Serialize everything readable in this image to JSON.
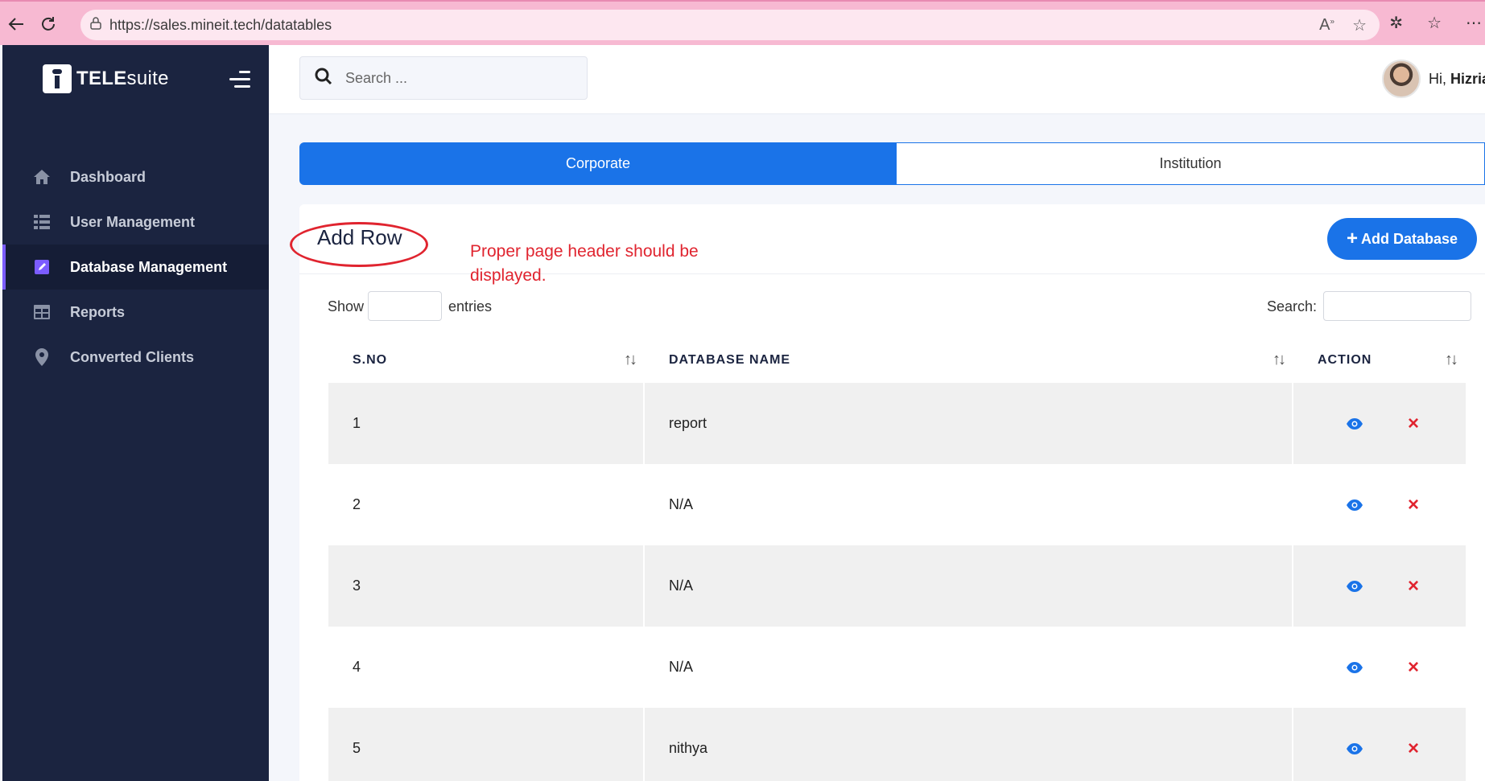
{
  "browser": {
    "url": "https://sales.mineit.tech/datatables",
    "back_icon": "arrow-left-icon",
    "reload_icon": "reload-icon",
    "lock_icon": "lock-icon"
  },
  "sidebar": {
    "brand_bold": "TELE",
    "brand_rest": "suite",
    "items": [
      {
        "label": "Dashboard",
        "icon": "home-icon"
      },
      {
        "label": "User Management",
        "icon": "list-icon"
      },
      {
        "label": "Database Management",
        "icon": "edit-icon",
        "active": true
      },
      {
        "label": "Reports",
        "icon": "table-icon"
      },
      {
        "label": "Converted Clients",
        "icon": "map-pin-icon"
      }
    ]
  },
  "header": {
    "search_placeholder": "Search ...",
    "greeting": "Hi,",
    "user_name": "Hizria"
  },
  "tabs": [
    {
      "label": "Corporate",
      "active": true
    },
    {
      "label": "Institution",
      "active": false
    }
  ],
  "card": {
    "title": "Add Row",
    "annotation": "Proper page header should be displayed.",
    "add_button": "Add Database",
    "show_label": "Show",
    "entries_label": "entries",
    "search_label": "Search:"
  },
  "table": {
    "columns": [
      "S.NO",
      "DATABASE NAME",
      "ACTION"
    ],
    "rows": [
      {
        "sno": "1",
        "name": "report"
      },
      {
        "sno": "2",
        "name": "N/A"
      },
      {
        "sno": "3",
        "name": "N/A"
      },
      {
        "sno": "4",
        "name": "N/A"
      },
      {
        "sno": "5",
        "name": "nithya"
      }
    ]
  },
  "colors": {
    "primary": "#1a73e8",
    "sidebar_bg": "#1b2440",
    "danger": "#e0242f",
    "chrome_pink": "#f7b9d2"
  }
}
